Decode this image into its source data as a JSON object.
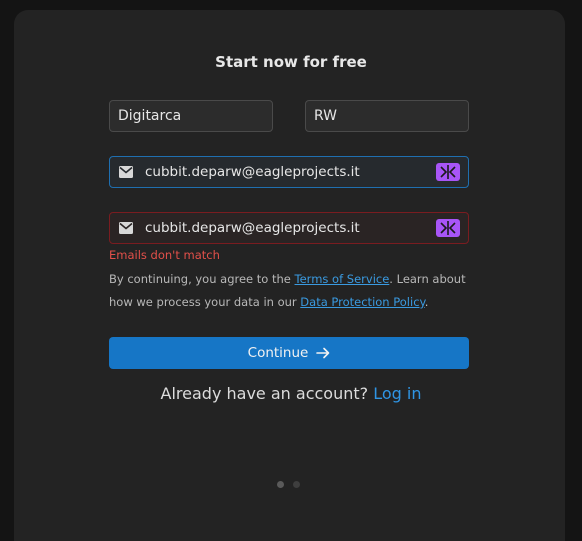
{
  "form": {
    "title": "Start now for free",
    "first_name_value": "Digitarca",
    "last_name_value": "RW",
    "email_value": "cubbit.deparw@eagleprojects.it",
    "confirm_email_value": "cubbit.deparw@eagleprojects.it",
    "error_text": "Emails don't match",
    "legal": {
      "prefix": "By continuing, you agree to the ",
      "terms_link": "Terms of Service",
      "middle": ". Learn about how we process your data in our ",
      "privacy_link": "Data Protection Policy",
      "suffix": "."
    },
    "continue_label": "Continue",
    "login_prompt": "Already have an account?",
    "login_link": "Log in"
  },
  "icons": {
    "mail": "mail-icon",
    "extension": "password-manager-icon",
    "continue": "arrow-right-icon"
  },
  "colors": {
    "accent": "#1676c6",
    "link": "#2f95e4",
    "error": "#e2504a",
    "extension_icon": "#a855f7"
  },
  "pagination": {
    "pages": 2,
    "active": 1
  }
}
